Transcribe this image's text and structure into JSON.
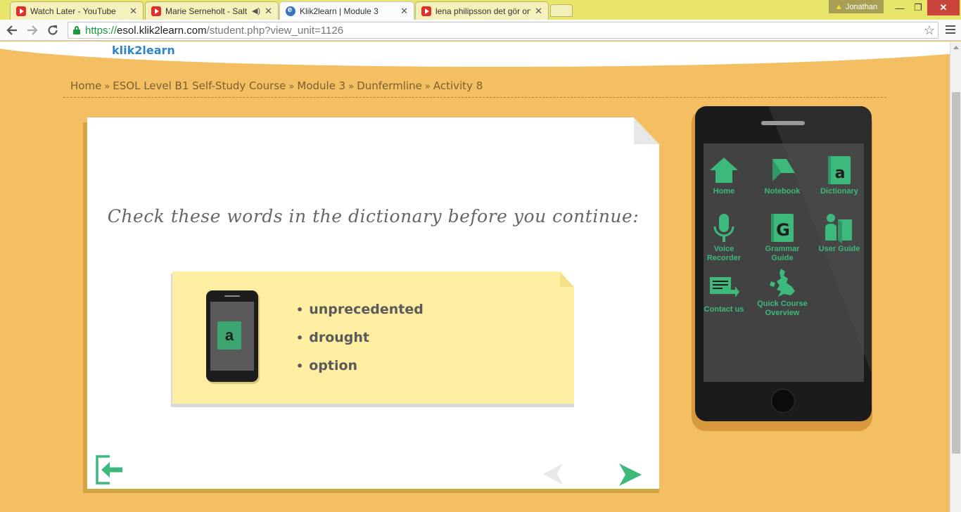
{
  "browser": {
    "tabs": [
      {
        "title": "Watch Later - YouTube",
        "favicon": "youtube-icon",
        "active": false
      },
      {
        "title": "Marie Serneholt - Salt (",
        "favicon": "youtube-icon",
        "active": false,
        "audio": true
      },
      {
        "title": "Klik2learn | Module 3",
        "favicon": "klik2learn-icon",
        "active": true
      },
      {
        "title": "lena philipsson det gör on",
        "favicon": "youtube-icon",
        "active": false
      }
    ],
    "profile_name": "Jonathan",
    "url": {
      "scheme": "https://",
      "host": "esol.klik2learn.com",
      "path": "/student.php?view_unit=1126"
    }
  },
  "site": {
    "logo": "klik2learn"
  },
  "breadcrumb": {
    "items": [
      "Home",
      "ESOL Level B1 Self-Study Course",
      "Module 3",
      "Dunfermline",
      "Activity 8"
    ],
    "separator": "»"
  },
  "activity": {
    "instruction": "Check these words in the dictionary before you continue:",
    "words": [
      "unprecedented",
      "drought",
      "option"
    ],
    "dictionary_letter": "a"
  },
  "phone_menu": {
    "apps": [
      {
        "label": "Home",
        "icon": "home-icon"
      },
      {
        "label": "Notebook",
        "icon": "notebook-icon"
      },
      {
        "label": "Dictionary",
        "icon": "dictionary-icon"
      },
      {
        "label": "Voice Recorder",
        "icon": "microphone-icon"
      },
      {
        "label": "Grammar Guide",
        "icon": "grammar-book-icon"
      },
      {
        "label": "User Guide",
        "icon": "user-guide-icon"
      },
      {
        "label": "Contact us",
        "icon": "envelope-icon"
      },
      {
        "label": "Quick Course Overview",
        "icon": "uk-map-icon"
      }
    ]
  },
  "colors": {
    "page_bg": "#f3bf62",
    "accent_green": "#3cb97b",
    "note_yellow": "#fdeea2",
    "tabbar": "#e9e46a"
  }
}
